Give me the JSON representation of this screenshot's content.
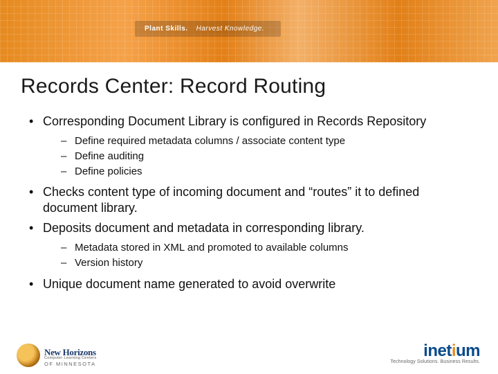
{
  "banner": {
    "pill_bold": "Plant Skills.",
    "pill_light": "Harvest Knowledge."
  },
  "title": "Records Center: Record Routing",
  "bullets": [
    {
      "text": "Corresponding Document Library is configured in Records Repository",
      "sub": [
        "Define required metadata columns / associate content type",
        "Define auditing",
        "Define policies"
      ]
    },
    {
      "text": "Checks content type of incoming document and “routes” it to defined document library.",
      "sub": []
    },
    {
      "text": "Deposits document and metadata in corresponding library.",
      "sub": [
        "Metadata stored in XML and promoted to available columns",
        "Version history"
      ]
    },
    {
      "text": "Unique document name generated to avoid overwrite",
      "sub": []
    }
  ],
  "footer": {
    "left": {
      "line1": "New Horizons",
      "line2": "Computer Learning Centers",
      "line3": "OF MINNESOTA"
    },
    "right": {
      "name_pre": "inet",
      "name_dot": "i",
      "name_post": "um",
      "tagline": "Technology Solutions. Business Results."
    }
  }
}
